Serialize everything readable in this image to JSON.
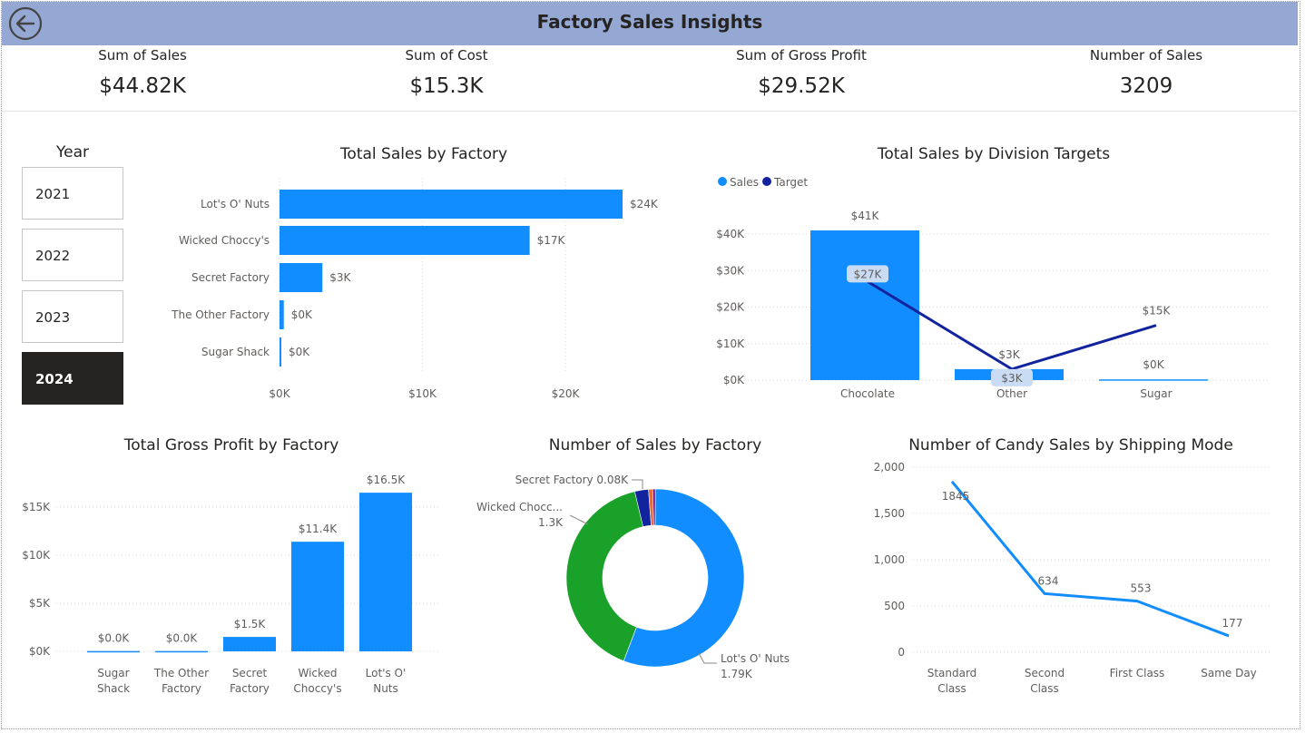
{
  "header": {
    "title": "Factory Sales Insights",
    "back_icon": "back-arrow-icon"
  },
  "kpis": [
    {
      "label": "Sum of Sales",
      "value": "$44.82K"
    },
    {
      "label": "Sum of Cost",
      "value": "$15.3K"
    },
    {
      "label": "Sum of Gross Profit",
      "value": "$29.52K"
    },
    {
      "label": "Number of Sales",
      "value": "3209"
    }
  ],
  "slicer": {
    "title": "Year",
    "options": [
      "2021",
      "2022",
      "2023",
      "2024"
    ],
    "selected": "2024"
  },
  "colors": {
    "primary": "#118dff",
    "target": "#12239e",
    "green": "#1aa12a",
    "red": "#e66c37"
  },
  "chart_data": [
    {
      "id": "sales_by_factory",
      "type": "bar",
      "orientation": "horizontal",
      "title": "Total Sales by Factory",
      "categories": [
        "Lot's O' Nuts",
        "Wicked Choccy's",
        "Secret Factory",
        "The Other Factory",
        "Sugar Shack"
      ],
      "values": [
        24000,
        17500,
        3000,
        300,
        100
      ],
      "data_labels": [
        "$24K",
        "$17K",
        "$3K",
        "$0K",
        "$0K"
      ],
      "xticks": [
        "$0K",
        "$10K",
        "$20K"
      ],
      "xlim": [
        0,
        24000
      ],
      "grid": true
    },
    {
      "id": "sales_by_division",
      "type": "bar",
      "title": "Total Sales by Division Targets",
      "legend": [
        "Sales",
        "Target"
      ],
      "legend_position": "top-left",
      "categories": [
        "Chocolate",
        "Other",
        "Sugar"
      ],
      "series": [
        {
          "name": "Sales",
          "type": "bar",
          "values": [
            41000,
            3000,
            200
          ],
          "labels": [
            "$41K",
            "$3K",
            "$0K"
          ]
        },
        {
          "name": "Target",
          "type": "line",
          "values": [
            27000,
            3000,
            15000
          ],
          "labels": [
            "$27K",
            "$3K",
            "$15K"
          ]
        }
      ],
      "yticks": [
        "$0K",
        "$10K",
        "$20K",
        "$30K",
        "$40K"
      ],
      "ylim": [
        0,
        40000
      ],
      "grid": true
    },
    {
      "id": "gross_profit_by_factory",
      "type": "bar",
      "title": "Total Gross Profit by Factory",
      "categories": [
        [
          "Sugar",
          "Shack"
        ],
        [
          "The Other",
          "Factory"
        ],
        [
          "Secret",
          "Factory"
        ],
        [
          "Wicked",
          "Choccy's"
        ],
        [
          "Lot's O'",
          "Nuts"
        ]
      ],
      "values": [
        30,
        30,
        1500,
        11400,
        16500
      ],
      "data_labels": [
        "$0.0K",
        "$0.0K",
        "$1.5K",
        "$11.4K",
        "$16.5K"
      ],
      "yticks": [
        "$0K",
        "$5K",
        "$10K",
        "$15K"
      ],
      "ylim": [
        0,
        15000
      ],
      "grid": true
    },
    {
      "id": "sales_count_by_factory",
      "type": "pie",
      "donut": true,
      "title": "Number of Sales by Factory",
      "slices": [
        {
          "name": "Lot's O' Nuts",
          "value": 1790,
          "label": [
            "Lot's O' Nuts",
            "1.79K"
          ],
          "color": "#118dff"
        },
        {
          "name": "Wicked Choccy's",
          "value": 1300,
          "label": [
            "Wicked Chocc...",
            "1.3K"
          ],
          "color": "#1aa12a"
        },
        {
          "name": "Secret Factory",
          "value": 80,
          "label": [
            "Secret Factory 0.08K"
          ],
          "color": "#12239e"
        },
        {
          "name": "The Other Factory",
          "value": 25,
          "label": [],
          "color": "#e66c37"
        },
        {
          "name": "Sugar Shack",
          "value": 14,
          "label": [],
          "color": "#6b007b"
        }
      ]
    },
    {
      "id": "candy_sales_by_shipping",
      "type": "line",
      "title": "Number of Candy Sales by Shipping Mode",
      "categories": [
        [
          "Standard",
          "Class"
        ],
        [
          "Second",
          "Class"
        ],
        [
          "First Class"
        ],
        [
          "Same Day"
        ]
      ],
      "values": [
        1845,
        634,
        553,
        177
      ],
      "data_labels": [
        "1845",
        "634",
        "553",
        "177"
      ],
      "yticks": [
        "0",
        "500",
        "1,000",
        "1,500",
        "2,000"
      ],
      "ylim": [
        0,
        2000
      ],
      "grid": true
    }
  ]
}
